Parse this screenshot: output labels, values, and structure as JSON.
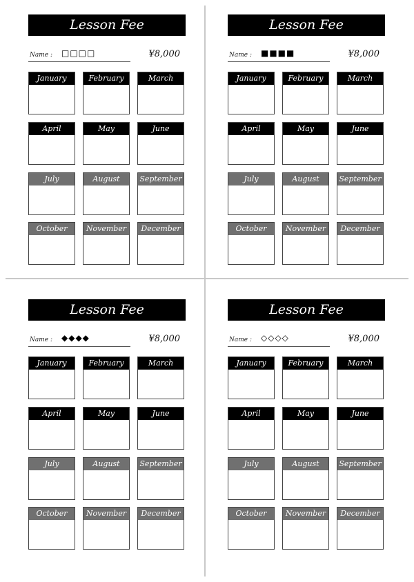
{
  "cards": [
    {
      "title": "Lesson Fee",
      "name_label": "Name :",
      "name_value": "□□□□",
      "fee": "¥8,000"
    },
    {
      "title": "Lesson Fee",
      "name_label": "Name :",
      "name_value": "■■■■",
      "fee": "¥8,000"
    },
    {
      "title": "Lesson Fee",
      "name_label": "Name :",
      "name_value": "◆◆◆◆",
      "fee": "¥8,000"
    },
    {
      "title": "Lesson Fee",
      "name_label": "Name :",
      "name_value": "◇◇◇◇",
      "fee": "¥8,000"
    }
  ],
  "months": [
    "January",
    "February",
    "March",
    "April",
    "May",
    "June",
    "July",
    "August",
    "September",
    "October",
    "November",
    "December"
  ],
  "colors": {
    "header_dark": "#000000",
    "header_gray": "#707070"
  }
}
